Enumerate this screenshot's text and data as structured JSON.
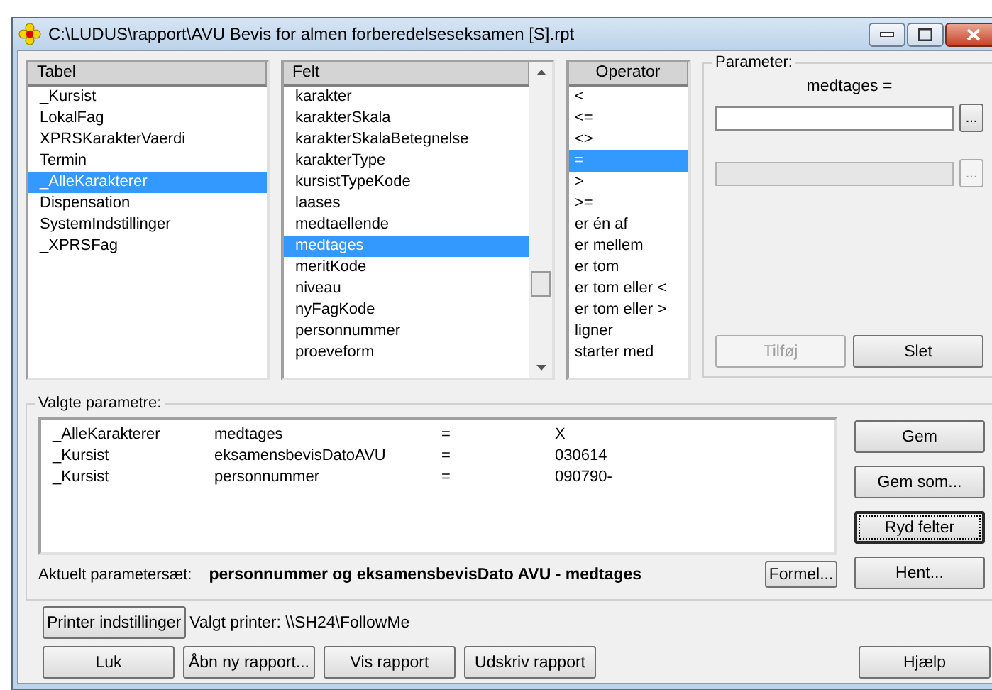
{
  "window": {
    "title": "C:\\LUDUS\\rapport\\AVU Bevis for almen forberedelseseksamen [S].rpt"
  },
  "lists": [
    {
      "header": "Tabel",
      "items": [
        {
          "label": "_Kursist",
          "selected": false
        },
        {
          "label": "LokalFag",
          "selected": false
        },
        {
          "label": "XPRSKarakterVaerdi",
          "selected": false
        },
        {
          "label": "Termin",
          "selected": false
        },
        {
          "label": "_AlleKarakterer",
          "selected": true
        },
        {
          "label": "Dispensation",
          "selected": false
        },
        {
          "label": "SystemIndstillinger",
          "selected": false
        },
        {
          "label": "_XPRSFag",
          "selected": false
        }
      ]
    },
    {
      "header": "Felt",
      "scrollbar": true,
      "items": [
        {
          "label": "karakter",
          "selected": false
        },
        {
          "label": "karakterSkala",
          "selected": false
        },
        {
          "label": "karakterSkalaBetegnelse",
          "selected": false
        },
        {
          "label": "karakterType",
          "selected": false
        },
        {
          "label": "kursistTypeKode",
          "selected": false
        },
        {
          "label": "laases",
          "selected": false
        },
        {
          "label": "medtaellende",
          "selected": false
        },
        {
          "label": "medtages",
          "selected": true
        },
        {
          "label": "meritKode",
          "selected": false
        },
        {
          "label": "niveau",
          "selected": false
        },
        {
          "label": "nyFagKode",
          "selected": false
        },
        {
          "label": "personnummer",
          "selected": false
        },
        {
          "label": "proeveform",
          "selected": false
        }
      ]
    },
    {
      "header": "Operator",
      "items": [
        {
          "label": "<",
          "selected": false
        },
        {
          "label": "<=",
          "selected": false
        },
        {
          "label": "<>",
          "selected": false
        },
        {
          "label": "=",
          "selected": true
        },
        {
          "label": ">",
          "selected": false
        },
        {
          "label": ">=",
          "selected": false
        },
        {
          "label": "er én af",
          "selected": false
        },
        {
          "label": "er mellem",
          "selected": false
        },
        {
          "label": "er tom",
          "selected": false
        },
        {
          "label": "er tom eller <",
          "selected": false
        },
        {
          "label": "er tom eller >",
          "selected": false
        },
        {
          "label": "ligner",
          "selected": false
        },
        {
          "label": "starter med",
          "selected": false
        }
      ]
    }
  ],
  "parameter": {
    "legend": "Parameter:",
    "caption": "medtages =",
    "fields": [
      {
        "button": "...",
        "disabled": false
      },
      {
        "button": "...",
        "disabled": true
      }
    ],
    "buttons": [
      {
        "label": "Tilføj",
        "disabled": true
      },
      {
        "label": "Slet",
        "disabled": false
      }
    ]
  },
  "selected_parameters": {
    "legend": "Valgte parametre:",
    "rows": [
      {
        "table": "_AlleKarakterer",
        "field": "medtages",
        "operator": "=",
        "value": "X"
      },
      {
        "table": "_Kursist",
        "field": "eksamensbevisDatoAVU",
        "operator": "=",
        "value": "030614"
      },
      {
        "table": "_Kursist",
        "field": "personnummer",
        "operator": "=",
        "value": "090790-"
      }
    ],
    "buttons": [
      {
        "label": "Gem",
        "focused": false
      },
      {
        "label": "Gem som...",
        "focused": false
      },
      {
        "label": "Ryd felter",
        "focused": true
      },
      {
        "label": "Hent...",
        "focused": false
      }
    ],
    "current_set_label": "Aktuelt parametersæt:",
    "current_set": "personnummer og eksamensbevisDato AVU - medtages",
    "formula_button": "Formel..."
  },
  "printer": {
    "button": "Printer indstillinger",
    "label": "Valgt printer: \\\\SH24\\FollowMe"
  },
  "bottom_buttons": [
    "Luk",
    "Åbn ny rapport...",
    "Vis rapport",
    "Udskriv rapport"
  ],
  "help_button": "Hjælp"
}
